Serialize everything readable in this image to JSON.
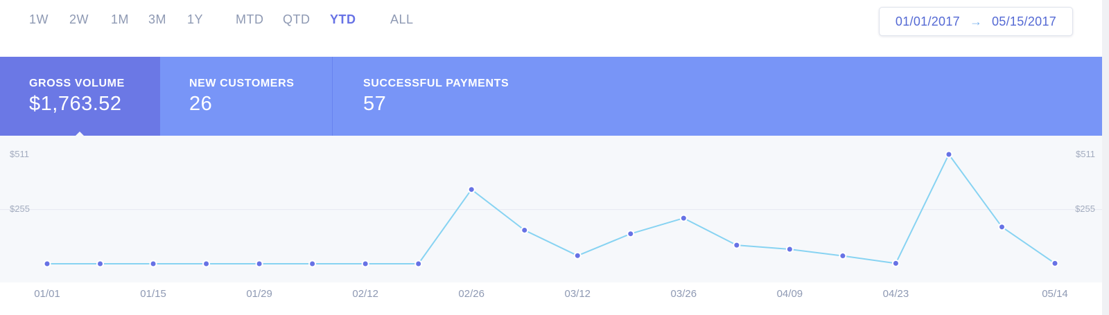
{
  "range_tabs": [
    {
      "label": "1W",
      "active": false
    },
    {
      "label": "2W",
      "active": false
    },
    {
      "label": "1M",
      "active": false
    },
    {
      "label": "3M",
      "active": false
    },
    {
      "label": "1Y",
      "active": false
    },
    {
      "label": "MTD",
      "active": false
    },
    {
      "label": "QTD",
      "active": false
    },
    {
      "label": "YTD",
      "active": true
    },
    {
      "label": "ALL",
      "active": false
    }
  ],
  "date_range": {
    "start": "01/01/2017",
    "end": "05/15/2017",
    "arrow_icon": "arrow-right-icon"
  },
  "metrics": [
    {
      "label": "GROSS VOLUME",
      "value": "$1,763.52",
      "active": true
    },
    {
      "label": "NEW CUSTOMERS",
      "value": "26",
      "active": false
    },
    {
      "label": "SUCCESSFUL PAYMENTS",
      "value": "57",
      "active": false
    }
  ],
  "colors": {
    "accent": "#6772e5",
    "metrics_bg": "#7895f7",
    "metric_active_bg": "#6b78e5",
    "line": "#87d3f2",
    "point": "#6772e5",
    "chart_bg": "#f6f8fb"
  },
  "chart_data": {
    "type": "line",
    "x": [
      "01/01",
      "01/08",
      "01/15",
      "01/22",
      "01/29",
      "02/05",
      "02/12",
      "02/19",
      "02/26",
      "03/05",
      "03/12",
      "03/19",
      "03/26",
      "04/02",
      "04/09",
      "04/16",
      "04/23",
      "04/30",
      "05/07",
      "05/14"
    ],
    "series": [
      {
        "values": [
          0,
          0,
          0,
          0,
          0,
          0,
          0,
          0,
          347,
          157,
          38,
          140,
          213,
          87,
          68,
          37,
          2,
          511,
          172,
          2
        ]
      }
    ],
    "x_tick_labels": [
      "01/01",
      "01/15",
      "01/29",
      "02/12",
      "02/26",
      "03/12",
      "03/26",
      "04/09",
      "04/23",
      "05/14"
    ],
    "y_tick_labels": [
      "$511",
      "$255"
    ],
    "y_ticks": [
      511,
      255
    ],
    "ylim": [
      0,
      511
    ],
    "grid": true
  }
}
